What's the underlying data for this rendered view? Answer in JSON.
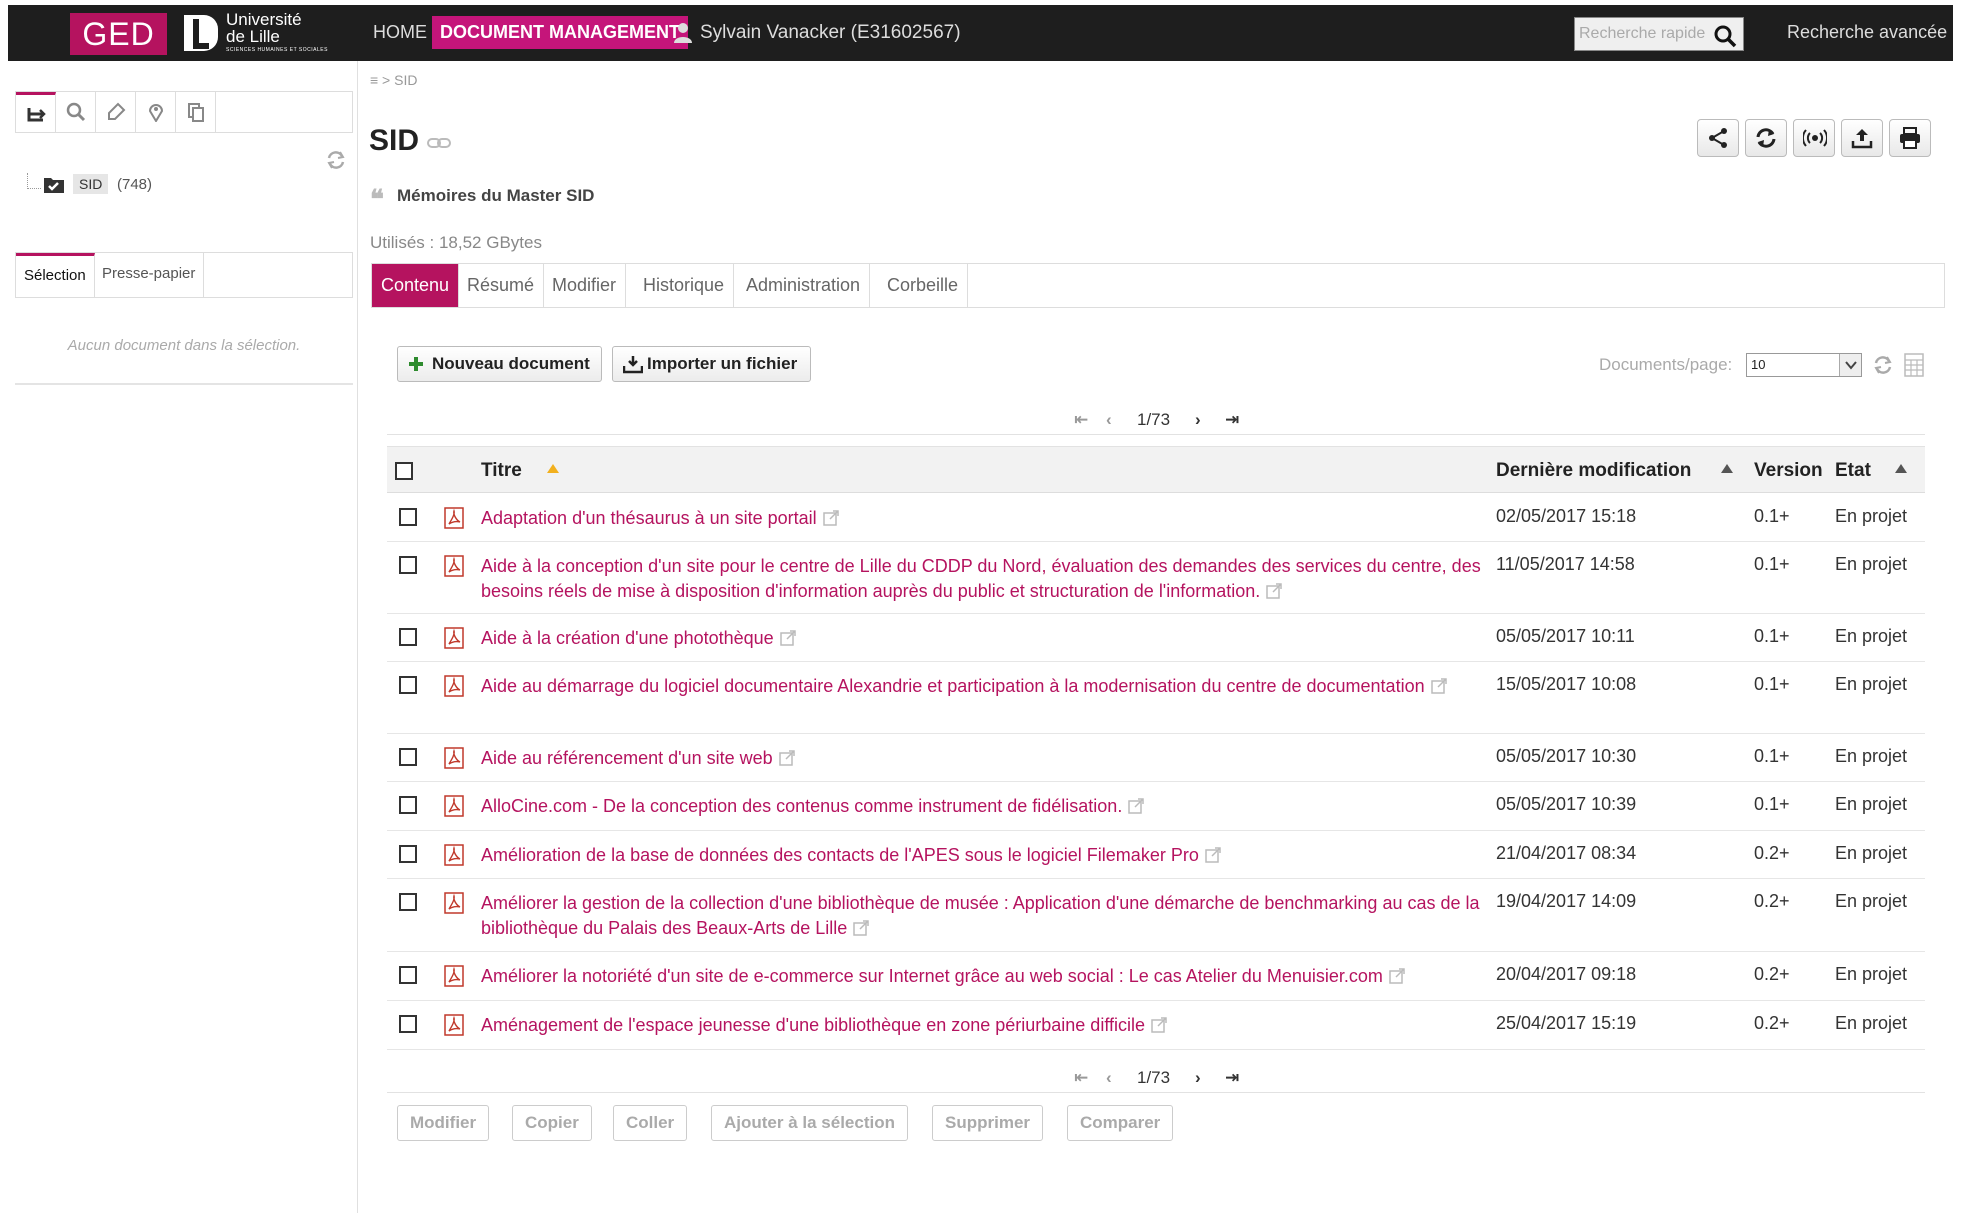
{
  "header": {
    "app_logo": "GED",
    "university_name_line1": "Université",
    "university_name_line2": "de Lille",
    "university_sub": "SCIENCES HUMAINES ET SOCIALES",
    "nav_home": "HOME",
    "nav_document_management": "DOCUMENT MANAGEMENT",
    "user": "Sylvain Vanacker (E31602567)",
    "quick_search_placeholder": "Recherche rapide",
    "advanced_search": "Recherche avancée"
  },
  "sidebar": {
    "tree": {
      "label": "SID",
      "count": "(748)"
    },
    "tabs": [
      "Sélection",
      "Presse-papier"
    ],
    "empty_message": "Aucun document dans la sélection."
  },
  "breadcrumb": "≡  > SID",
  "page": {
    "title": "SID",
    "subtitle": "Mémoires du Master SID",
    "usage": "Utilisés : 18,52 GBytes",
    "accent_color": "#b5135f"
  },
  "tabs": [
    "Contenu",
    "Résumé",
    "Modifier",
    "Historique",
    "Administration",
    "Corbeille"
  ],
  "toolbar": {
    "new_document": "Nouveau document",
    "import_file": "Importer un fichier",
    "docs_per_page_label": "Documents/page:",
    "docs_per_page_value": "10"
  },
  "pagination": {
    "current": "1/73"
  },
  "table": {
    "headers": {
      "title": "Titre",
      "modified": "Dernière modification",
      "version": "Version",
      "state": "Etat"
    },
    "rows": [
      {
        "title": "Adaptation d'un thésaurus à un site portail",
        "modified": "02/05/2017 15:18",
        "version": "0.1+",
        "state": "En projet"
      },
      {
        "title": "Aide à la conception d'un site pour le centre de Lille du CDDP du Nord, évaluation des demandes des services du centre, des besoins réels de mise à disposition d'information auprès du public et structuration de l'information.",
        "modified": "11/05/2017 14:58",
        "version": "0.1+",
        "state": "En projet"
      },
      {
        "title": "Aide à la création d'une photothèque",
        "modified": "05/05/2017 10:11",
        "version": "0.1+",
        "state": "En projet"
      },
      {
        "title": "Aide au démarrage du logiciel documentaire Alexandrie et participation à la modernisation du centre de documentation",
        "modified": "15/05/2017 10:08",
        "version": "0.1+",
        "state": "En projet"
      },
      {
        "title": "Aide au référencement d'un site web",
        "modified": "05/05/2017 10:30",
        "version": "0.1+",
        "state": "En projet"
      },
      {
        "title": "AlloCine.com - De la conception des contenus comme instrument de fidélisation.",
        "modified": "05/05/2017 10:39",
        "version": "0.1+",
        "state": "En projet"
      },
      {
        "title": "Amélioration de la base de données des contacts de l'APES sous le logiciel Filemaker Pro",
        "modified": "21/04/2017 08:34",
        "version": "0.2+",
        "state": "En projet"
      },
      {
        "title": "Améliorer la gestion de la collection d'une bibliothèque de musée : Application d'une démarche de benchmarking au cas de la bibliothèque du Palais des Beaux-Arts de Lille",
        "modified": "19/04/2017 14:09",
        "version": "0.2+",
        "state": "En projet"
      },
      {
        "title": "Améliorer la notoriété d'un site de e-commerce sur Internet grâce au web social : Le cas Atelier du Menuisier.com",
        "modified": "20/04/2017 09:18",
        "version": "0.2+",
        "state": "En projet"
      },
      {
        "title": "Aménagement de l'espace jeunesse d'une bibliothèque en zone périurbaine difficile",
        "modified": "25/04/2017 15:19",
        "version": "0.2+",
        "state": "En projet"
      }
    ]
  },
  "bottom_actions": [
    "Modifier",
    "Copier",
    "Coller",
    "Ajouter à la sélection",
    "Supprimer",
    "Comparer"
  ]
}
